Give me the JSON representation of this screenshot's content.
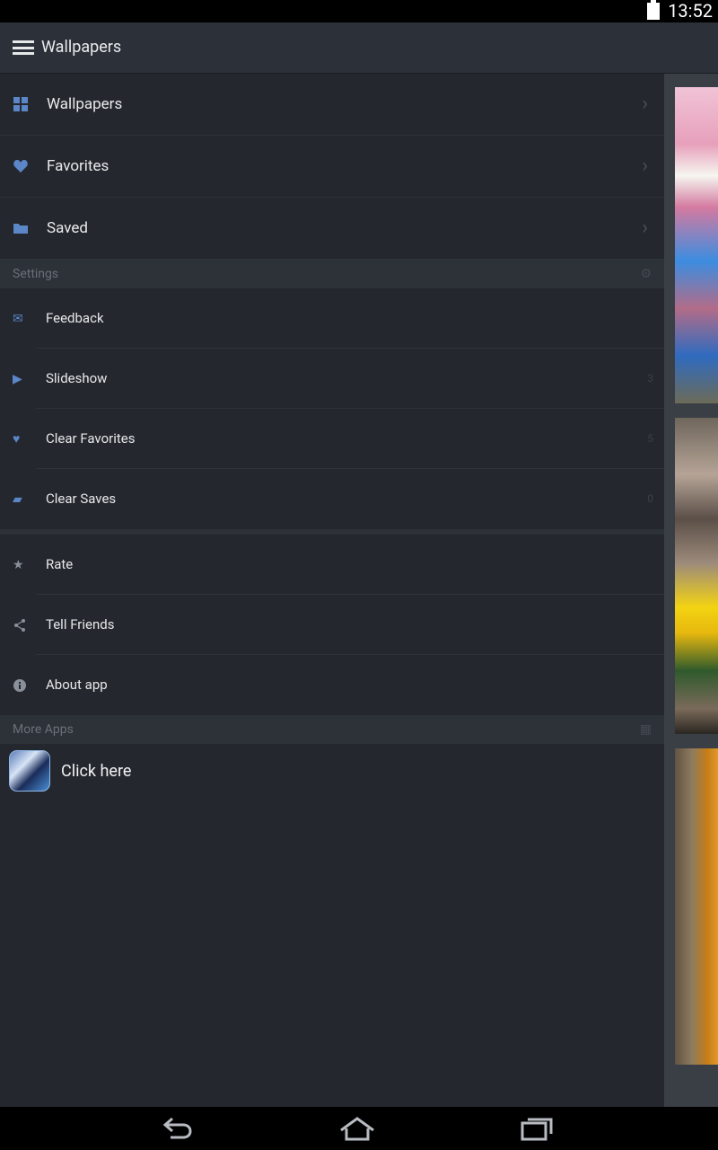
{
  "status_bar": {
    "time": "13:52"
  },
  "action_bar": {
    "title": "Wallpapers"
  },
  "drawer": {
    "nav": [
      {
        "label": "Wallpapers",
        "icon": "grid-icon"
      },
      {
        "label": "Favorites",
        "icon": "heart-icon"
      },
      {
        "label": "Saved",
        "icon": "folder-icon"
      }
    ],
    "settings_header": "Settings",
    "settings": [
      {
        "label": "Feedback",
        "count": ""
      },
      {
        "label": "Slideshow",
        "count": "3"
      },
      {
        "label": "Clear Favorites",
        "count": "5"
      },
      {
        "label": "Clear Saves",
        "count": "0"
      }
    ],
    "misc": [
      {
        "label": "Rate"
      },
      {
        "label": "Tell Friends"
      },
      {
        "label": "About app"
      }
    ],
    "more_apps_header": "More Apps",
    "more_app_label": "Click here"
  },
  "colors": {
    "accent": "#5b86c8",
    "background": "#24272d",
    "section": "#2d3138"
  }
}
